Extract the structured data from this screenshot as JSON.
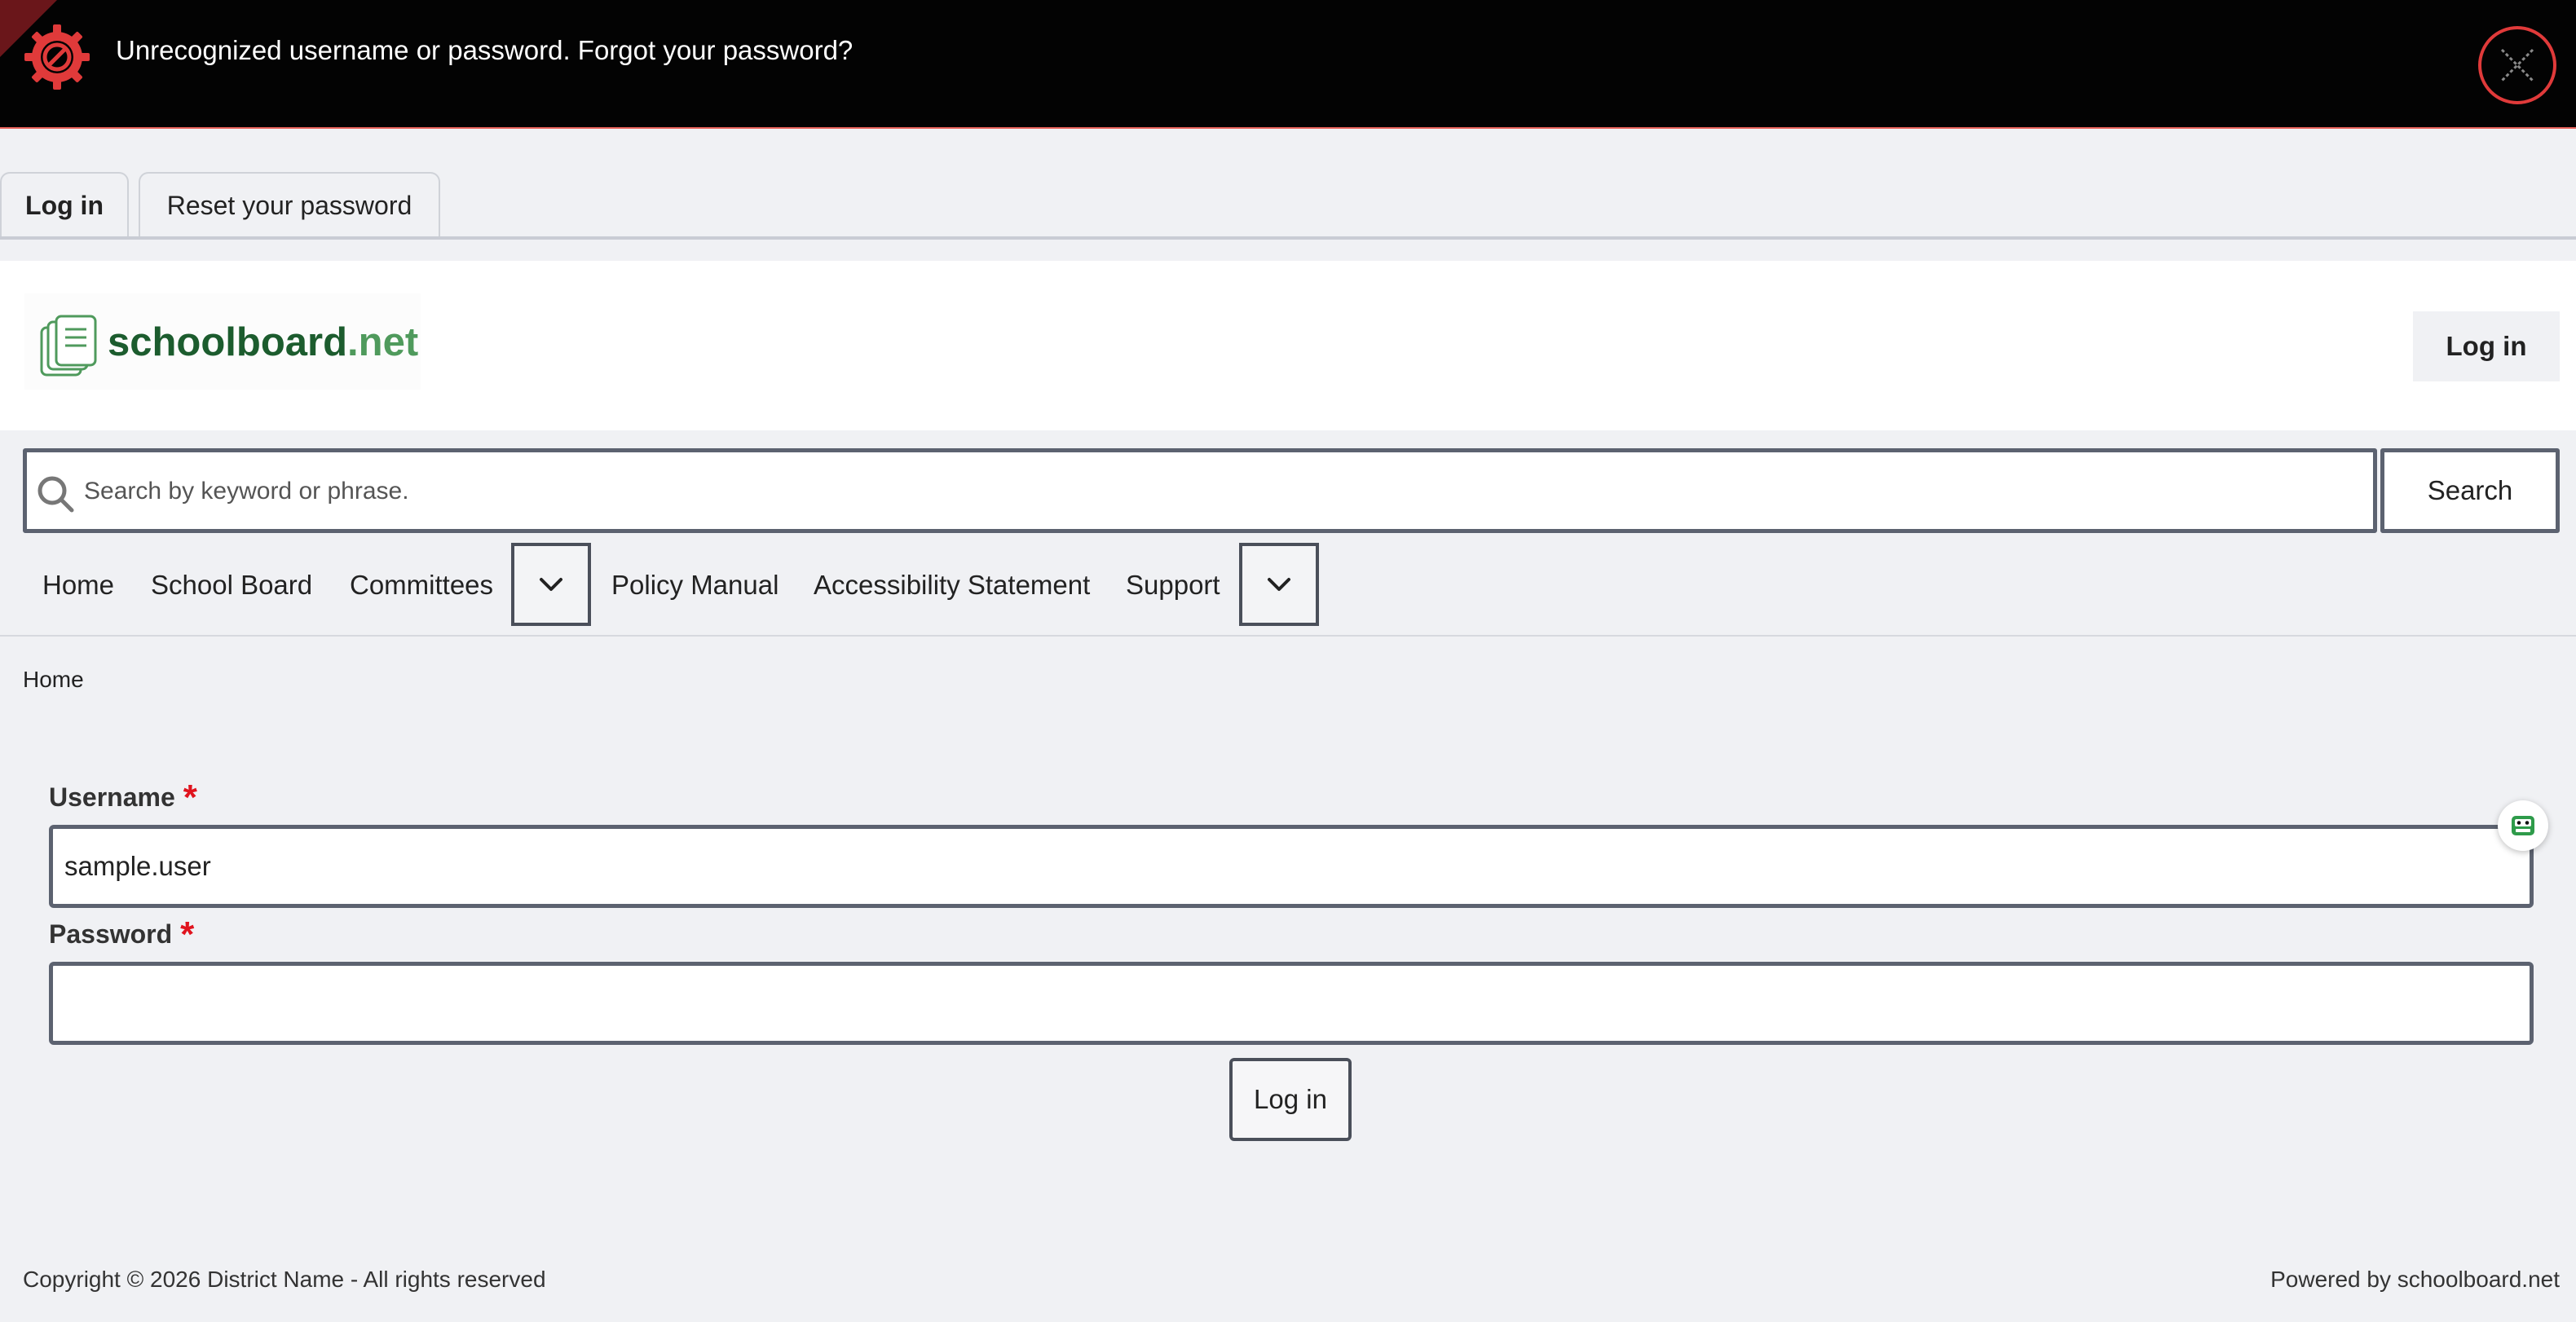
{
  "alert": {
    "message": "Unrecognized username or password. Forgot your password?",
    "icon": "blocked-gear-icon",
    "close_icon": "close-icon",
    "colors": {
      "background": "#030303",
      "accent": "#e03a3a"
    }
  },
  "tabs": [
    {
      "label": "Log in",
      "active": true
    },
    {
      "label": "Reset your password",
      "active": false
    }
  ],
  "header": {
    "logo_name": "schoolboard",
    "logo_tld": ".net",
    "login_label": "Log in",
    "colors": {
      "logo_dark": "#1c5c2e",
      "logo_light": "#4f9a5c"
    }
  },
  "search": {
    "placeholder": "Search by keyword or phrase.",
    "value": "",
    "button_label": "Search"
  },
  "nav": {
    "items": [
      {
        "label": "Home"
      },
      {
        "label": "School Board"
      },
      {
        "label": "Committees"
      },
      {
        "label": "Policy Manual"
      },
      {
        "label": "Accessibility Statement"
      },
      {
        "label": "Support"
      }
    ]
  },
  "breadcrumb": {
    "items": [
      "Home"
    ]
  },
  "form": {
    "username_label": "Username",
    "username_value": "sample.user",
    "password_label": "Password",
    "password_value": "",
    "required_mark": "*",
    "submit_label": "Log in"
  },
  "footer": {
    "copyright": "Copyright © 2026 District Name - All rights reserved",
    "powered_by": "Powered by schoolboard.net"
  }
}
